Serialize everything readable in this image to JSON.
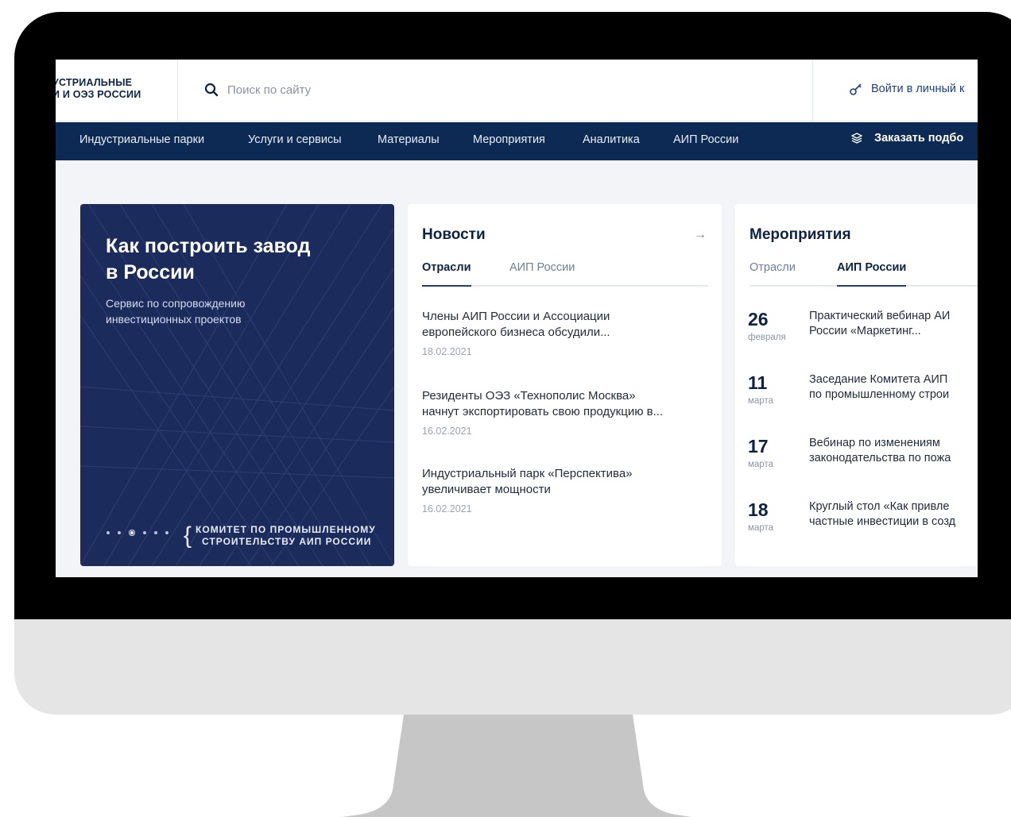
{
  "header": {
    "logo_line1": "УСТРИАЛЬНЫЕ",
    "logo_line2": "И И ОЭЗ РОССИИ",
    "search_placeholder": "Поиск по сайту",
    "login_label": "Войти в личный к"
  },
  "nav": {
    "items": [
      {
        "label": "Индустриальные парки"
      },
      {
        "label": "Услуги и сервисы"
      },
      {
        "label": "Материалы"
      },
      {
        "label": "Мероприятия"
      },
      {
        "label": "Аналитика"
      },
      {
        "label": "АИП России"
      }
    ],
    "order_label": "Заказать подбо"
  },
  "hero": {
    "title": "Как построить завод в России",
    "subtitle": "Сервис по сопровождению инвестиционных проектов",
    "committee_line1": "КОМИТЕТ ПО ПРОМЫШЛЕННОМУ",
    "committee_line2": "СТРОИТЕЛЬСТВУ АИП РОССИИ",
    "slides_total": 6,
    "active_slide": 3
  },
  "news": {
    "title": "Новости",
    "arrow": "→",
    "tabs": [
      {
        "label": "Отрасли",
        "active": true
      },
      {
        "label": "АИП России",
        "active": false
      }
    ],
    "items": [
      {
        "title_line1": "Члены АИП России и Ассоциации",
        "title_line2": "европейского бизнеса обсудили...",
        "date": "18.02.2021"
      },
      {
        "title_line1": "Резиденты ОЭЗ «Технополис Москва»",
        "title_line2": "начнут экспортировать свою продукцию в...",
        "date": "16.02.2021"
      },
      {
        "title_line1": "Индустриальный парк «Перспектива»",
        "title_line2": "увеличивает мощности",
        "date": "16.02.2021"
      }
    ]
  },
  "events": {
    "title": "Мероприятия",
    "tabs": [
      {
        "label": "Отрасли",
        "active": false
      },
      {
        "label": "АИП России",
        "active": true
      }
    ],
    "items": [
      {
        "day": "26",
        "month": "февраля",
        "title_line1": "Практический вебинар АИ",
        "title_line2": "России «Маркетинг..."
      },
      {
        "day": "11",
        "month": "марта",
        "title_line1": "Заседание Комитета АИП",
        "title_line2": "по промышленному строи"
      },
      {
        "day": "17",
        "month": "марта",
        "title_line1": "Вебинар по изменениям",
        "title_line2": "законодательства по пожа"
      },
      {
        "day": "18",
        "month": "марта",
        "title_line1": "Круглый стол «Как привле",
        "title_line2": "частные инвестиции в созд"
      }
    ]
  },
  "colors": {
    "nav_bg": "#0d2a54",
    "hero_bg": "#1b2c5c",
    "brand_dark": "#0d2346",
    "accent": "#1c3f8c",
    "page_bg": "#f2f4f7",
    "bezel": "#000000",
    "chin": "#e5e5e5",
    "stand": "#c6c6c6"
  },
  "icons": {
    "search": "search-icon",
    "login": "key-icon",
    "order": "layers-icon",
    "arrow": "arrow-right-icon"
  }
}
